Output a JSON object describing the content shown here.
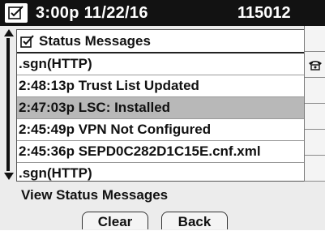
{
  "status_bar": {
    "datetime": "3:00p 11/22/16",
    "extension": "115012",
    "icon": "phone-status-icon"
  },
  "list": {
    "header_title": "Status Messages",
    "header_icon": "status-messages-icon",
    "selected_index": 2,
    "items": [
      ".sgn(HTTP)",
      "2:48:13p Trust List Updated",
      "2:47:03p LSC: Installed",
      "2:45:49p VPN Not Configured",
      "2:45:36p SEPD0C282D1C15E.cnf.xml",
      ".sgn(HTTP)"
    ]
  },
  "line_keys": {
    "count": 6,
    "icons": [
      "",
      "phone-handset-icon",
      "",
      "",
      "",
      ""
    ]
  },
  "prompt": "View Status Messages",
  "softkeys": {
    "clear": "Clear",
    "back": "Back"
  },
  "colors": {
    "topbar_bg": "#121212",
    "selected_row": "#b8b8b8",
    "screen_bg": "#ececec"
  }
}
